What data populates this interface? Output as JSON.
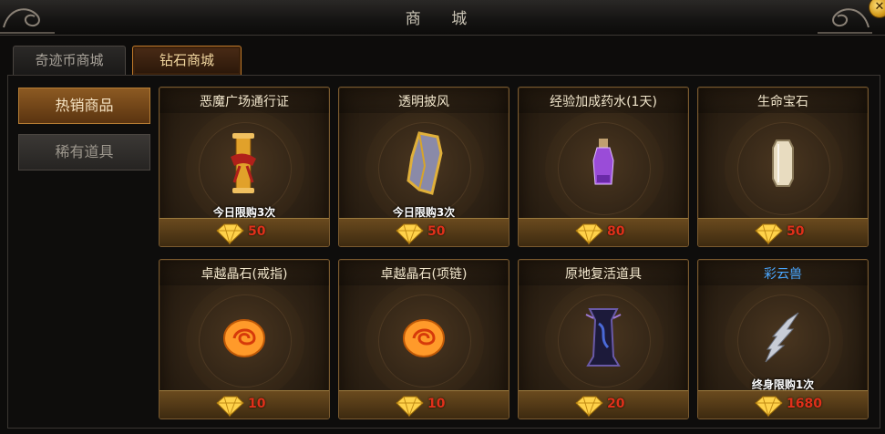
{
  "window": {
    "title": "商 城"
  },
  "tabs": [
    {
      "label": "奇迹币商城",
      "active": false
    },
    {
      "label": "钻石商城",
      "active": true
    }
  ],
  "sidebar": [
    {
      "label": "热销商品",
      "active": true
    },
    {
      "label": "稀有道具",
      "active": false
    }
  ],
  "currency_icon": "diamond-icon",
  "items": [
    {
      "name": "恶魔广场通行证",
      "limit": "今日限购3次",
      "price": "50",
      "icon": "scroll-icon"
    },
    {
      "name": "透明披风",
      "limit": "今日限购3次",
      "price": "50",
      "icon": "cloak-icon"
    },
    {
      "name": "经验加成药水(1天)",
      "limit": "",
      "price": "80",
      "icon": "potion-icon"
    },
    {
      "name": "生命宝石",
      "limit": "",
      "price": "50",
      "icon": "gem-crystal-icon"
    },
    {
      "name": "卓越晶石(戒指)",
      "limit": "",
      "price": "10",
      "icon": "orange-stone-icon"
    },
    {
      "name": "卓越晶石(项链)",
      "limit": "",
      "price": "10",
      "icon": "orange-stone-icon"
    },
    {
      "name": "原地复活道具",
      "limit": "",
      "price": "20",
      "icon": "revive-scroll-icon"
    },
    {
      "name": "彩云兽",
      "limit": "终身限购1次",
      "price": "1680",
      "icon": "wing-icon",
      "name_color": "#4aa7ff"
    }
  ]
}
